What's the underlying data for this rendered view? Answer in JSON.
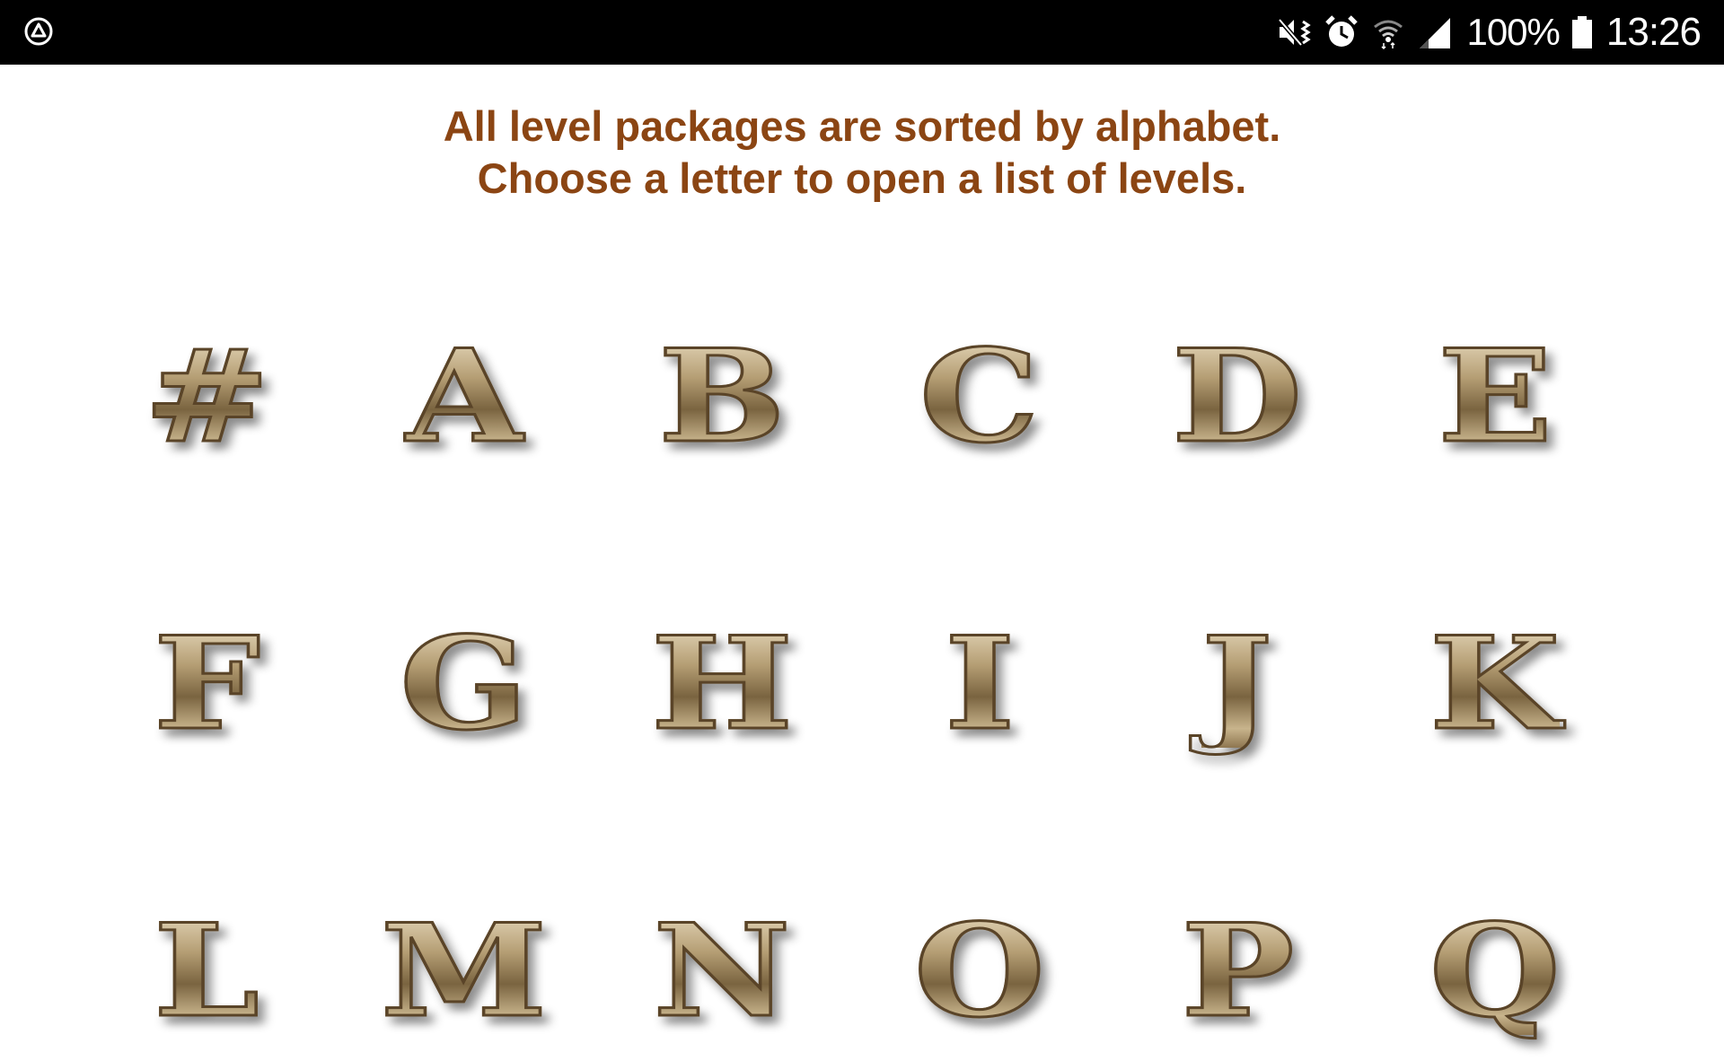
{
  "status_bar": {
    "left_icon": "autoplay-triangle-circle-icon",
    "icons": [
      "mute-vibrate-icon",
      "alarm-icon",
      "wifi-icon",
      "cell-signal-icon"
    ],
    "battery_percent": "100%",
    "battery_icon": "battery-full-icon",
    "time": "13:26"
  },
  "instructions": {
    "line1": "All level packages are sorted by alphabet.",
    "line2": "Choose a letter to open a list of levels."
  },
  "letters": [
    "#",
    "A",
    "B",
    "C",
    "D",
    "E",
    "F",
    "G",
    "H",
    "I",
    "J",
    "K",
    "L",
    "M",
    "N",
    "O",
    "P",
    "Q"
  ],
  "colors": {
    "instruction_text": "#8b4513",
    "status_bar_bg": "#000000",
    "letter_gold": "#a08a62"
  }
}
